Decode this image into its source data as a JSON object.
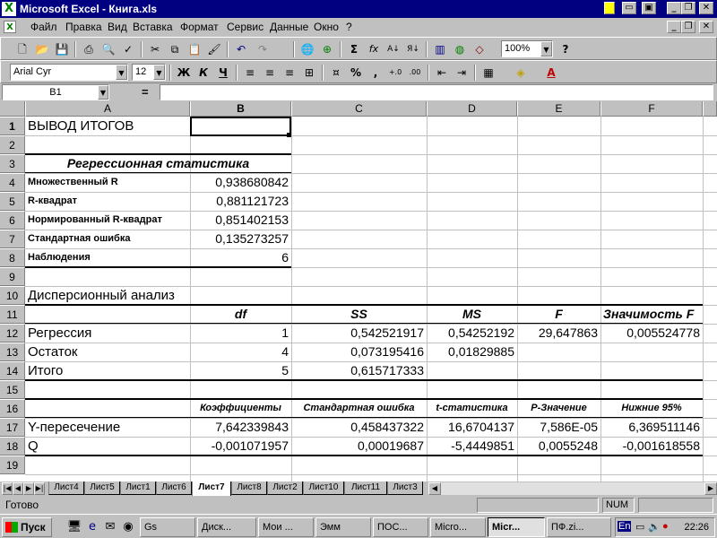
{
  "window": {
    "app_icon": "X",
    "title": "Microsoft Excel - Книга.xls"
  },
  "menu": [
    {
      "label": "Файл"
    },
    {
      "label": "Правка"
    },
    {
      "label": "Вид"
    },
    {
      "label": "Вставка"
    },
    {
      "label": "Формат"
    },
    {
      "label": "Сервис"
    },
    {
      "label": "Данные"
    },
    {
      "label": "Окно"
    },
    {
      "label": "?"
    }
  ],
  "toolbar": {
    "zoom": "100%",
    "font_name": "Arial Cyr",
    "font_size": "12",
    "bold": "Ж",
    "italic": "К",
    "underline": "Ч",
    "percent": "%",
    "comma": ",",
    "sum": "Σ",
    "fx": "fx"
  },
  "formula_bar": {
    "name_box": "B1",
    "equals": "=",
    "content": ""
  },
  "columns": [
    "A",
    "B",
    "C",
    "D",
    "E",
    "F"
  ],
  "rows": [
    "1",
    "2",
    "3",
    "4",
    "5",
    "6",
    "7",
    "8",
    "9",
    "10",
    "11",
    "12",
    "13",
    "14",
    "15",
    "16",
    "17",
    "18",
    "19"
  ],
  "cells": {
    "A1": "ВЫВОД ИТОГОВ",
    "A3": "Регрессионная статистика",
    "A4": "Множественный R",
    "B4": "0,938680842",
    "A5": "R-квадрат",
    "B5": "0,881121723",
    "A6": "Нормированный R-квадрат",
    "B6": "0,851402153",
    "A7": "Стандартная ошибка",
    "B7": "0,135273257",
    "A8": "Наблюдения",
    "B8": "6",
    "A10": "Дисперсионный анализ",
    "B11": "df",
    "C11": "SS",
    "D11": "MS",
    "E11": "F",
    "F11": "Значимость F",
    "A12": "Регрессия",
    "B12": "1",
    "C12": "0,542521917",
    "D12": "0,54252192",
    "E12": "29,647863",
    "F12": "0,005524778",
    "A13": "Остаток",
    "B13": "4",
    "C13": "0,073195416",
    "D13": "0,01829885",
    "A14": "Итого",
    "B14": "5",
    "C14": "0,615717333",
    "B16": "Коэффициенты",
    "C16": "Стандартная ошибка",
    "D16": "t-статистика",
    "E16": "P-Значение",
    "F16": "Нижние 95%",
    "A17": "Y-пересечение",
    "B17": "7,642339843",
    "C17": "0,458437322",
    "D17": "16,6704137",
    "E17": "7,586E-05",
    "F17": "6,369511146",
    "A18": "Q",
    "B18": "-0,001071957",
    "C18": "0,00019687",
    "D18": "-5,4449851",
    "E18": "0,0055248",
    "F18": "-0,001618558"
  },
  "sheet_tabs": [
    "Лист4",
    "Лист5",
    "Лист1",
    "Лист6",
    "Лист7",
    "Лист8",
    "Лист2",
    "Лист10",
    "Лист11",
    "Лист3"
  ],
  "active_sheet": "Лист7",
  "status": {
    "text": "Готово",
    "num": "NUM"
  },
  "taskbar": {
    "start": "Пуск",
    "tasks": [
      "Gs",
      "Диск...",
      "Мои ...",
      "Эмм",
      "ПОС...",
      "Micro...",
      "Micr...",
      "ПФ.zi..."
    ],
    "active_task": "Micr...",
    "lang": "En",
    "clock": "22:26"
  },
  "colors": {
    "title_bar": "#000080",
    "chrome": "#c0c0c0",
    "grid_line": "#c0c0c0",
    "sheet": "#ffffff"
  }
}
